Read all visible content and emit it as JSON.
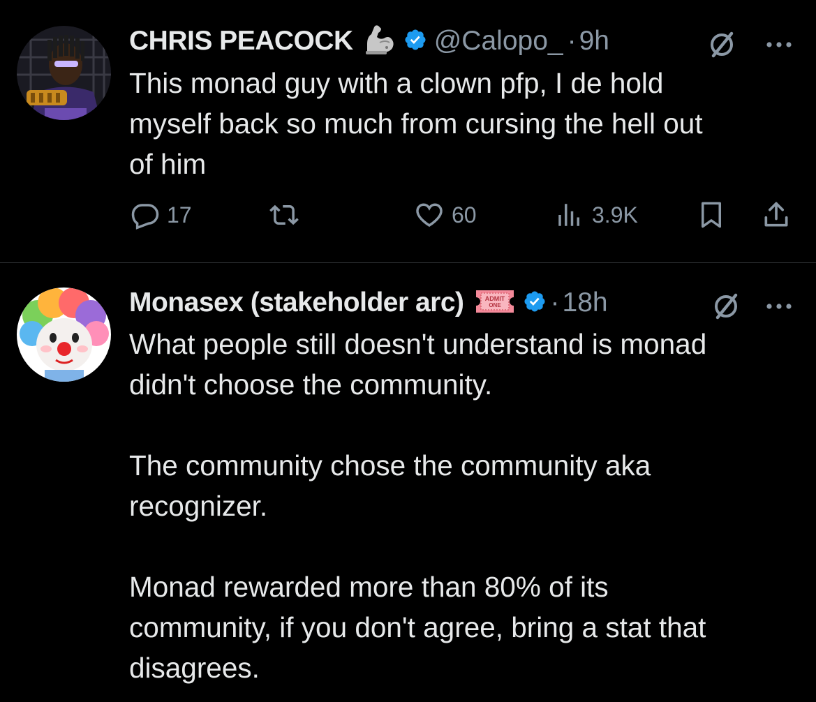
{
  "tweets": [
    {
      "display_name": "CHRIS PEACOCK",
      "badge_emoji": "flexed-biceps",
      "handle": "@Calopo_",
      "separator": "·",
      "time": "9h",
      "text": "This monad guy with a clown pfp, I de hold\nmyself back so much from cursing the hell out\nof him",
      "replies": "17",
      "likes": "60",
      "views": "3.9K"
    },
    {
      "display_name": "Monasex (stakeholder arc)",
      "badge_emoji": "admission-ticket",
      "ticket_line1": "ADMIT",
      "ticket_line2": "ONE",
      "separator": "·",
      "time": "18h",
      "text": "What people still doesn't understand is monad\ndidn't choose the community.\n\nThe community chose the community aka\nrecognizer.\n\nMonad rewarded more than 80% of its\ncommunity, if you don't agree, bring a stat that\ndisagrees."
    }
  ],
  "colors": {
    "background": "#000000",
    "text_primary": "#e7e9ea",
    "text_secondary": "#8b98a5",
    "verified_blue": "#1d9bf0",
    "divider": "#2f3336"
  }
}
